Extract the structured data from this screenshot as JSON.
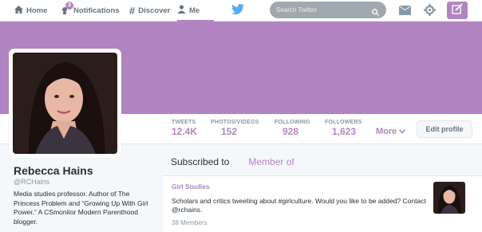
{
  "nav": {
    "home": "Home",
    "notifications": "Notifications",
    "notifications_badge": "3",
    "discover": "Discover",
    "me": "Me",
    "search_placeholder": "Search Twitter"
  },
  "colors": {
    "accent": "#b285c2",
    "muted": "#8899a6",
    "text": "#292f33"
  },
  "profile": {
    "name": "Rebecca Hains",
    "handle": "@RCHains",
    "bio": "Media studies professor. Author of The Princess Problem and “Growing Up With Girl Power.” A CSmonitor Modern Parenthood blogger."
  },
  "stats": [
    {
      "label": "TWEETS",
      "value": "12.4K"
    },
    {
      "label": "PHOTOS/VIDEOS",
      "value": "152"
    },
    {
      "label": "FOLLOWING",
      "value": "928"
    },
    {
      "label": "FOLLOWERS",
      "value": "1,623"
    }
  ],
  "more_label": "More",
  "edit_profile_label": "Edit profile",
  "tabs": {
    "subscribed": "Subscribed to",
    "member": "Member of"
  },
  "list": {
    "title": "Girl Studies",
    "description": "Scholars and critics tweeting about #girlculture. Would you like to be added? Contact @rchains.",
    "members": "38 Members"
  }
}
